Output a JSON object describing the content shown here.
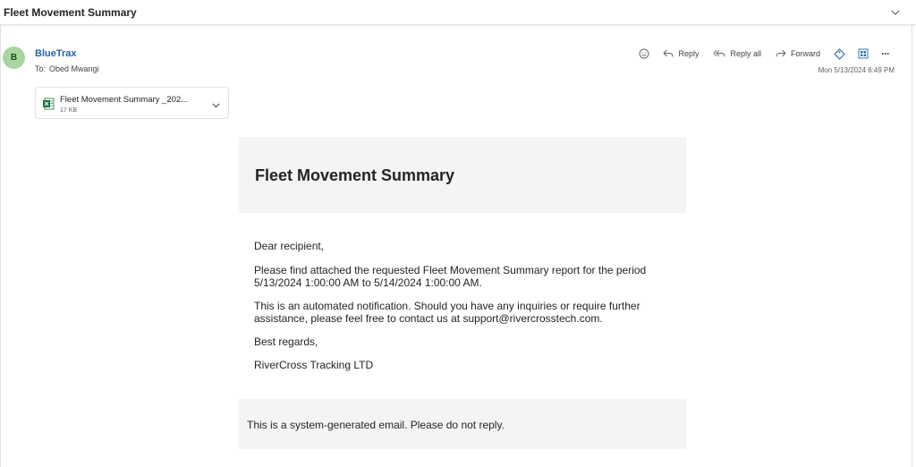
{
  "email": {
    "subject": "Fleet Movement Summary",
    "sender": {
      "initial": "B",
      "name": "BlueTrax",
      "to_prefix": "To:",
      "to_name": "Obed Mwangi"
    },
    "actions": {
      "reply": "Reply",
      "reply_all": "Reply all",
      "forward": "Forward",
      "more": "···"
    },
    "timestamp": "Mon 5/13/2024 6:49 PM",
    "attachment": {
      "name": "Fleet Movement Summary _202...",
      "size": "17 KB",
      "icon": "excel-file-icon"
    },
    "body": {
      "title": "Fleet Movement Summary",
      "greeting": "Dear recipient,",
      "paragraph1": "Please find attached the requested Fleet Movement Summary report for the period 5/13/2024 1:00:00 AM to 5/14/2024 1:00:00 AM.",
      "paragraph2": "This is an automated notification. Should you have any inquiries or require further assistance, please feel free to contact us at support@rivercrosstech.com.",
      "closing": "Best regards,",
      "signature": "RiverCross Tracking LTD",
      "footer": "This is a system-generated email. Please do not reply."
    }
  },
  "colors": {
    "accent": "#2563a8",
    "avatar_bg": "#a8d5a0",
    "panel_bg": "#f4f4f4",
    "excel_green": "#1d6f42"
  }
}
